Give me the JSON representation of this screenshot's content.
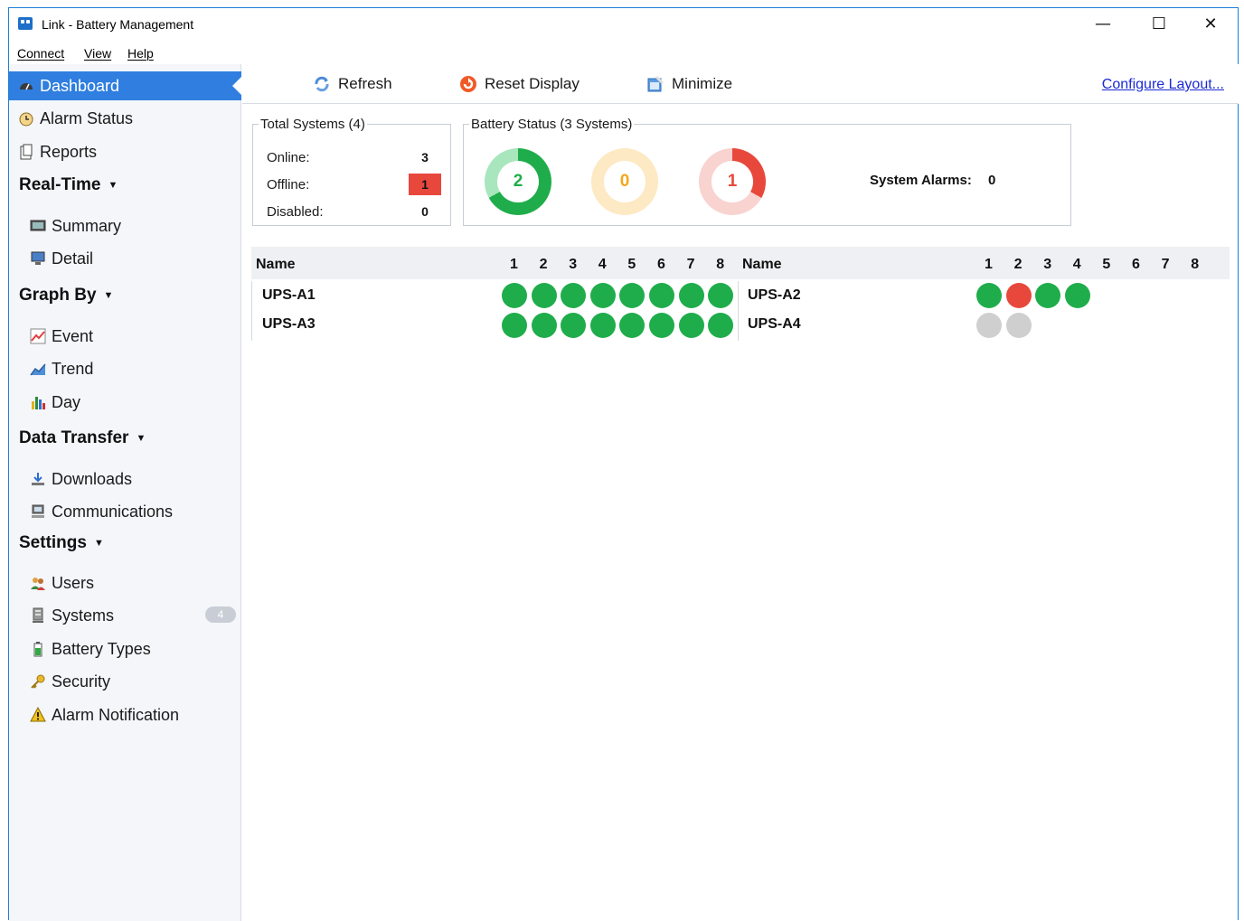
{
  "window": {
    "title": "Link - Battery Management",
    "minimize_glyph": "—",
    "maximize_glyph": "☐",
    "close_glyph": "✕"
  },
  "menubar": {
    "items": [
      "Connect",
      "View",
      "Help"
    ]
  },
  "sidebar": {
    "dashboard": "Dashboard",
    "alarm_status": "Alarm Status",
    "reports": "Reports",
    "realtime_header": "Real-Time",
    "summary": "Summary",
    "detail": "Detail",
    "graph_header": "Graph By",
    "event": "Event",
    "trend": "Trend",
    "day": "Day",
    "data_transfer_header": "Data Transfer",
    "downloads": "Downloads",
    "communications": "Communications",
    "settings_header": "Settings",
    "users": "Users",
    "systems": "Systems",
    "systems_badge": "4",
    "battery_types": "Battery Types",
    "security": "Security",
    "alarm_notification": "Alarm Notification",
    "caret": "▼"
  },
  "toolbar": {
    "refresh": "Refresh",
    "reset_display": "Reset Display",
    "minimize": "Minimize",
    "configure_layout": "Configure Layout..."
  },
  "total_systems": {
    "legend": "Total Systems (4)",
    "online_label": "Online:",
    "online_value": "3",
    "offline_label": "Offline:",
    "offline_value": "1",
    "disabled_label": "Disabled:",
    "disabled_value": "0"
  },
  "battery_status": {
    "legend": "Battery Status (3 Systems)",
    "donuts": [
      {
        "value": "2",
        "fraction": 0.67,
        "color": "#1fad4b",
        "track": "#a8e6bd"
      },
      {
        "value": "0",
        "fraction": 0.0,
        "color": "#f2a81e",
        "track": "#fde9c4"
      },
      {
        "value": "1",
        "fraction": 0.33,
        "color": "#e8483c",
        "track": "#f8d3d0"
      }
    ],
    "system_alarms_label": "System Alarms:",
    "system_alarms_value": "0"
  },
  "grid": {
    "name_header": "Name",
    "columns": [
      "1",
      "2",
      "3",
      "4",
      "5",
      "6",
      "7",
      "8"
    ],
    "left_rows": [
      {
        "name": "UPS-A1",
        "cells": [
          "green",
          "green",
          "green",
          "green",
          "green",
          "green",
          "green",
          "green"
        ]
      },
      {
        "name": "UPS-A3",
        "cells": [
          "green",
          "green",
          "green",
          "green",
          "green",
          "green",
          "green",
          "green"
        ]
      }
    ],
    "right_rows": [
      {
        "name": "UPS-A2",
        "cells": [
          "green",
          "red",
          "green",
          "green"
        ]
      },
      {
        "name": "UPS-A4",
        "cells": [
          "gray",
          "gray"
        ]
      }
    ]
  }
}
